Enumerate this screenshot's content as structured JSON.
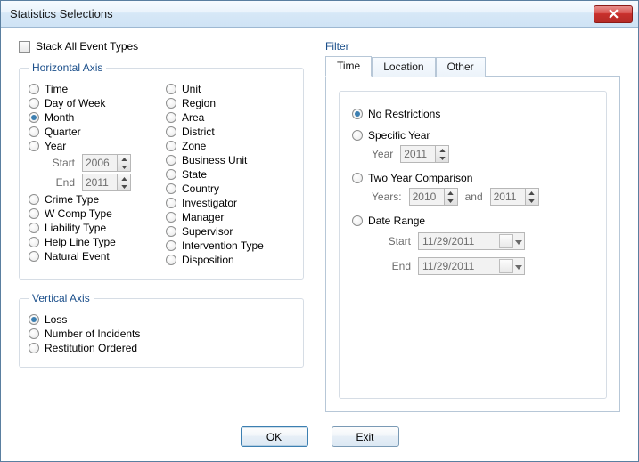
{
  "window": {
    "title": "Statistics Selections"
  },
  "stack_label": "Stack All Event Types",
  "horizontal": {
    "legend": "Horizontal Axis",
    "selected": "Month",
    "col1": [
      "Time",
      "Day of Week",
      "Month",
      "Quarter",
      "Year"
    ],
    "year_start_label": "Start",
    "year_start_value": "2006",
    "year_end_label": "End",
    "year_end_value": "2011",
    "col1b": [
      "Crime Type",
      "W Comp Type",
      "Liability Type",
      "Help Line Type",
      "Natural Event"
    ],
    "col2": [
      "Unit",
      "Region",
      "Area",
      "District",
      "Zone",
      "Business Unit",
      "State",
      "Country",
      "Investigator",
      "Manager",
      "Supervisor",
      "Intervention Type",
      "Disposition"
    ]
  },
  "vertical": {
    "legend": "Vertical Axis",
    "selected": "Loss",
    "items": [
      "Loss",
      "Number of Incidents",
      "Restitution Ordered"
    ]
  },
  "filter": {
    "label": "Filter",
    "tabs": [
      "Time",
      "Location",
      "Other"
    ],
    "active_tab": "Time",
    "selected": "No Restrictions",
    "no_restrictions": "No Restrictions",
    "specific_year": "Specific Year",
    "specific_year_label": "Year",
    "specific_year_value": "2011",
    "two_year": "Two Year Comparison",
    "two_year_label": "Years:",
    "two_year_a": "2010",
    "two_year_and": "and",
    "two_year_b": "2011",
    "date_range": "Date Range",
    "date_start_label": "Start",
    "date_start_value": "11/29/2011",
    "date_end_label": "End",
    "date_end_value": "11/29/2011"
  },
  "buttons": {
    "ok": "OK",
    "exit": "Exit"
  }
}
